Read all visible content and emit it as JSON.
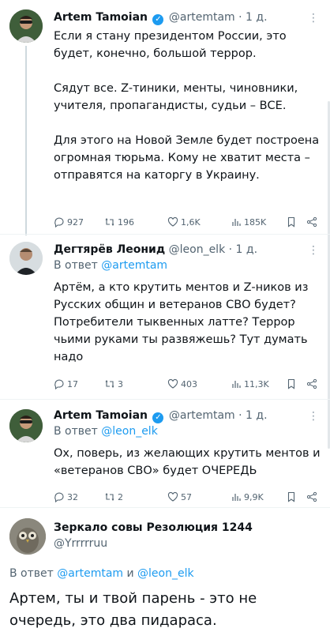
{
  "tweets": [
    {
      "name": "Artem Tamoian",
      "handle": "@artemtam",
      "separator": "·",
      "time": "1 д.",
      "body": "Если я стану президентом России, это будет, конечно, большой террор.\n\nСядут все. Z-тиники, менты, чиновники, учителя, пропагандисты, судьи – ВСЕ.\n\nДля этого на Новой Земле будет построена огромная тюрьма. Кому не хватит места – отправятся на каторгу в Украину.",
      "replies": "927",
      "retweets": "196",
      "likes": "1,6K",
      "views": "185K"
    },
    {
      "name": "Дегтярёв Леонид",
      "handle": "@leon_elk",
      "separator": "·",
      "time": "1 д.",
      "reply_prefix": "В ответ",
      "reply_to": "@artemtam",
      "body": "Артём, а кто крутить ментов и Z-ников из Русских общин и ветеранов СВО будет? Потребители тыквенных латте? Террор чьими руками ты развяжешь? Тут думать надо",
      "replies": "17",
      "retweets": "3",
      "likes": "403",
      "views": "11,3K"
    },
    {
      "name": "Artem Tamoian",
      "handle": "@artemtam",
      "separator": "·",
      "time": "1 д.",
      "reply_prefix": "В ответ",
      "reply_to": "@leon_elk",
      "body": "Ох, поверь, из желающих крутить ментов и «ветеранов СВО» будет ОЧЕРЕДЬ",
      "replies": "32",
      "retweets": "2",
      "likes": "57",
      "views": "9,9K"
    },
    {
      "name": "Зеркало совы Резолюция 1244",
      "handle": "@Yrrrrruu",
      "reply_prefix": "В ответ",
      "reply_to_1": "@artemtam",
      "reply_and": "и",
      "reply_to_2": "@leon_elk",
      "body": "Артем, ты и твой парень - это не очередь, это два пидараса."
    }
  ],
  "icons": {
    "reply": "reply-icon",
    "retweet": "retweet-icon",
    "like": "heart-icon",
    "views": "views-icon",
    "bookmark": "bookmark-icon",
    "share": "share-icon",
    "verified": "verified-icon",
    "more": "more-icon"
  },
  "colors": {
    "accent": "#1d9bf0",
    "text": "#0f1419",
    "secondary": "#536471",
    "divider": "#eff3f4"
  }
}
